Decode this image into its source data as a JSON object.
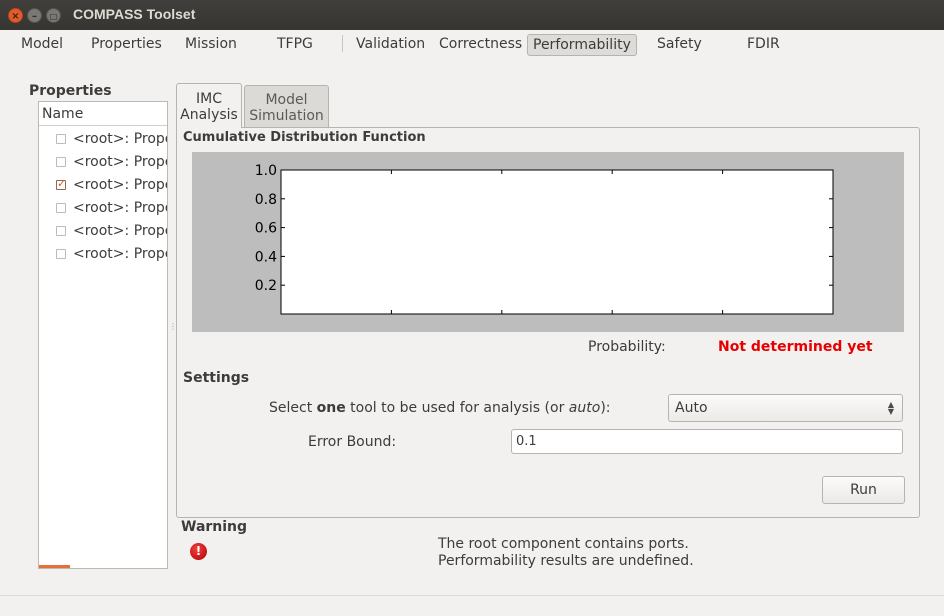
{
  "window": {
    "title": "COMPASS Toolset",
    "close_glyph": "×",
    "min_glyph": "–",
    "max_glyph": "□"
  },
  "main_tabs": [
    {
      "label": "Model"
    },
    {
      "label": "Properties"
    },
    {
      "label": "Mission"
    },
    {
      "label": "TFPG"
    },
    {
      "label": "Validation"
    },
    {
      "label": "Correctness"
    },
    {
      "label": "Performability",
      "active": true
    },
    {
      "label": "Safety"
    },
    {
      "label": "FDIR"
    }
  ],
  "properties": {
    "title": "Properties",
    "column_header": "Name",
    "items": [
      {
        "label": "<root>: Prope",
        "checked": false
      },
      {
        "label": "<root>: Prope",
        "checked": false
      },
      {
        "label": "<root>: Prope",
        "checked": true
      },
      {
        "label": "<root>: Prope",
        "checked": false
      },
      {
        "label": "<root>: Prope",
        "checked": false
      },
      {
        "label": "<root>: Prope",
        "checked": false
      }
    ]
  },
  "sub_tabs": [
    {
      "line1": "IMC",
      "line2": "Analysis",
      "active": true
    },
    {
      "line1": "Model",
      "line2": "Simulation",
      "active": false
    }
  ],
  "cdf": {
    "title": "Cumulative Distribution Function",
    "probability_label": "Probability:",
    "probability_value": "Not determined yet",
    "probability_color": "#e60000"
  },
  "chart_data": {
    "type": "line",
    "title": "",
    "xlabel": "",
    "ylabel": "",
    "ylim": [
      0.0,
      1.0
    ],
    "y_ticks": [
      "0.2",
      "0.4",
      "0.6",
      "0.8",
      "1.0"
    ],
    "series": [],
    "grid": false
  },
  "settings": {
    "title": "Settings",
    "tool_label_pre": "Select ",
    "tool_label_bold": "one",
    "tool_label_mid": " tool to be used for analysis (or ",
    "tool_label_italic": "auto",
    "tool_label_post": "):",
    "tool_value": "Auto",
    "error_label": "Error Bound:",
    "error_value": "0.1",
    "run_label": "Run"
  },
  "warning": {
    "title": "Warning",
    "icon": "error-icon",
    "icon_glyph": "!",
    "lines": [
      "The root component contains ports.",
      "Performability results are undefined."
    ]
  }
}
